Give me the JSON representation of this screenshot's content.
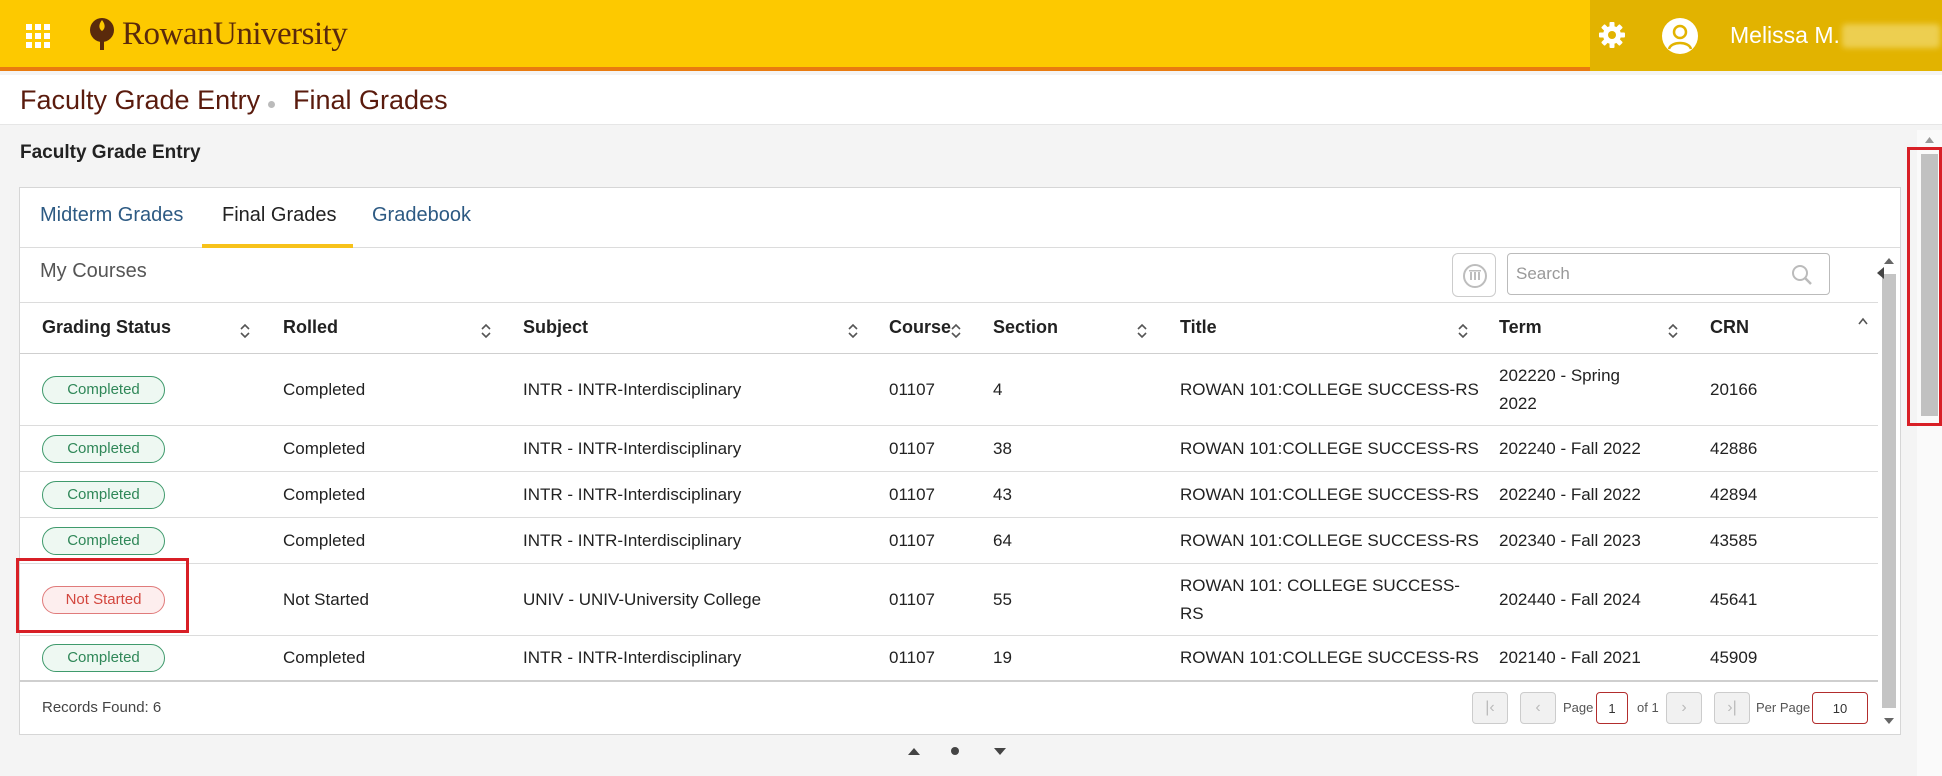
{
  "header": {
    "app_grid_icon": "app-grid-icon",
    "logo_text": "RowanUniversity",
    "settings_icon": "gear-icon",
    "user_icon": "user-avatar-icon",
    "user_name": "Melissa M."
  },
  "breadcrumb": {
    "items": [
      "Faculty Grade Entry",
      "Final Grades"
    ]
  },
  "page_title": "Faculty Grade Entry",
  "tabs": [
    {
      "label": "Midterm Grades",
      "active": false
    },
    {
      "label": "Final Grades",
      "active": true
    },
    {
      "label": "Gradebook",
      "active": false
    }
  ],
  "section_title": "My Courses",
  "search": {
    "placeholder": "Search",
    "value": ""
  },
  "table": {
    "columns": [
      "Grading Status",
      "Rolled",
      "Subject",
      "Course",
      "Section",
      "Title",
      "Term",
      "CRN"
    ],
    "rows": [
      {
        "status": "Completed",
        "rolled": "Completed",
        "subject": "INTR - INTR-Interdisciplinary",
        "course": "01107",
        "section": "4",
        "title": "ROWAN 101:COLLEGE SUCCESS-RS",
        "term_l1": "202220 - Spring",
        "term_l2": "2022",
        "crn": "20166"
      },
      {
        "status": "Completed",
        "rolled": "Completed",
        "subject": "INTR - INTR-Interdisciplinary",
        "course": "01107",
        "section": "38",
        "title": "ROWAN 101:COLLEGE SUCCESS-RS",
        "term": "202240 - Fall 2022",
        "crn": "42886"
      },
      {
        "status": "Completed",
        "rolled": "Completed",
        "subject": "INTR - INTR-Interdisciplinary",
        "course": "01107",
        "section": "43",
        "title": "ROWAN 101:COLLEGE SUCCESS-RS",
        "term": "202240 - Fall 2022",
        "crn": "42894"
      },
      {
        "status": "Completed",
        "rolled": "Completed",
        "subject": "INTR - INTR-Interdisciplinary",
        "course": "01107",
        "section": "64",
        "title": "ROWAN 101:COLLEGE SUCCESS-RS",
        "term": "202340 - Fall 2023",
        "crn": "43585"
      },
      {
        "status": "Not Started",
        "rolled": "Not Started",
        "subject": "UNIV - UNIV-University College",
        "course": "01107",
        "section": "55",
        "title_l1": "ROWAN 101: COLLEGE SUCCESS-",
        "title_l2": "RS",
        "term": "202440 - Fall 2024",
        "crn": "45641"
      },
      {
        "status": "Completed",
        "rolled": "Completed",
        "subject": "INTR - INTR-Interdisciplinary",
        "course": "01107",
        "section": "19",
        "title": "ROWAN 101:COLLEGE SUCCESS-RS",
        "term": "202140 - Fall 2021",
        "crn": "45909"
      }
    ]
  },
  "footer": {
    "records": "Records Found: 6",
    "page_label": "Page",
    "page_value": "1",
    "of_label": "of 1",
    "per_page_label": "Per Page",
    "per_page_value": "10"
  },
  "colors": {
    "header_bg": "#fdc900",
    "header_accent": "#e97b0f",
    "brand_text": "#5a1b0d",
    "completed": "#2f8758",
    "not_started": "#d3463e",
    "highlight": "#d81f26"
  }
}
